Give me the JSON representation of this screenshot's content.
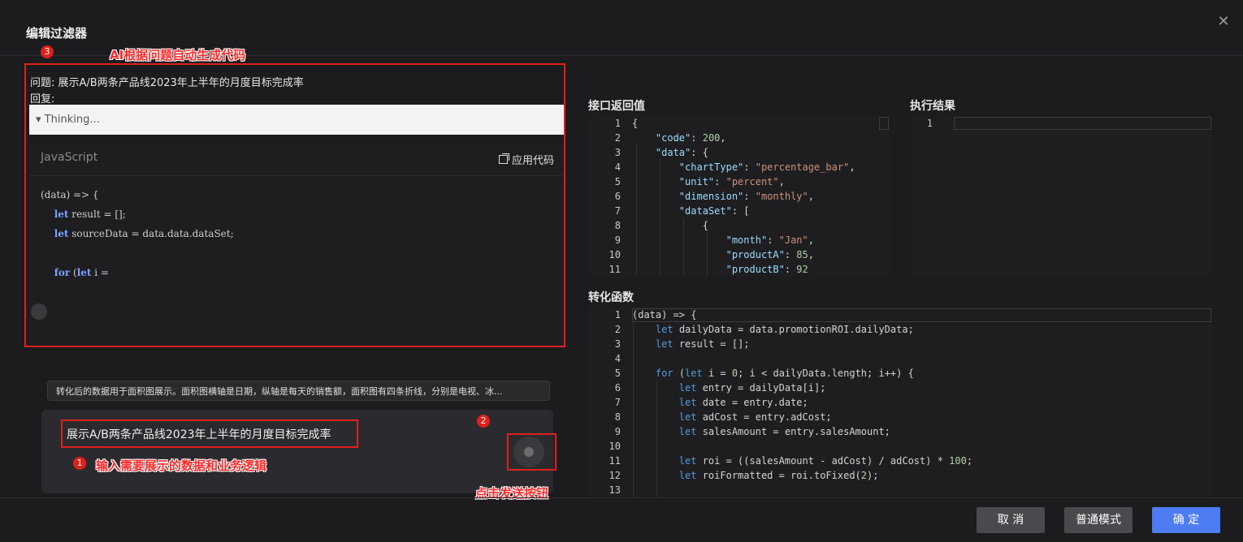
{
  "dialog": {
    "title": "编辑过滤器",
    "close_icon": "close-icon"
  },
  "annotations": {
    "note3_num": "3",
    "note3_text": "AI根据问题自动生成代码",
    "note1_num": "1",
    "note1_text": "输入需要展示的数据和业务逻辑",
    "note2_num": "2",
    "note2_text": "点击发送按钮",
    "accent_color": "#e0201c"
  },
  "conversation": {
    "question_label": "问题: 展示A/B两条产品线2023年上半年的月度目标完成率",
    "reply_label": "回复:",
    "thinking": "▾ Thinking...",
    "code_language": "JavaScript",
    "apply_code": "应用代码",
    "code_lines": [
      "(data) => {",
      "    let result = [];",
      "    let sourceData = data.data.dataSet;",
      "",
      "    for (let i ="
    ]
  },
  "suggestion": "转化后的数据用于面积图展示。面积图横轴是日期，纵轴是每天的销售额，面积图有四条折线，分别是电视、冰...",
  "input": {
    "value": "展示A/B两条产品线2023年上半年的月度目标完成率"
  },
  "api_panel": {
    "label": "接口返回值",
    "line_numbers": [
      "1",
      "2",
      "3",
      "4",
      "5",
      "6",
      "7",
      "8",
      "9",
      "10",
      "11"
    ]
  },
  "result_panel": {
    "label": "执行结果",
    "line_numbers": [
      "1"
    ]
  },
  "transform_panel": {
    "label": "转化函数",
    "line_numbers": [
      "1",
      "2",
      "3",
      "4",
      "5",
      "6",
      "7",
      "8",
      "9",
      "10",
      "11",
      "12",
      "13"
    ]
  },
  "footer": {
    "cancel": "取 消",
    "normal_mode": "普通模式",
    "confirm": "确 定",
    "confirm_color": "#4d7cf3"
  }
}
